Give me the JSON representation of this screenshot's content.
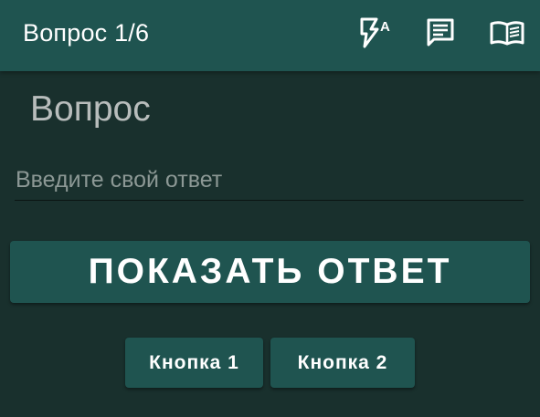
{
  "app_bar": {
    "title": "Вопрос 1/6",
    "actions": [
      {
        "icon": "flash-auto-icon",
        "label": "A"
      },
      {
        "icon": "message-icon"
      },
      {
        "icon": "book-icon"
      }
    ]
  },
  "question": {
    "label": "Вопрос"
  },
  "answer": {
    "placeholder": "Введите свой ответ",
    "value": ""
  },
  "show_answer_button": {
    "label": "ПОКАЗАТЬ ОТВЕТ"
  },
  "buttons": [
    {
      "label": "Кнопка 1"
    },
    {
      "label": "Кнопка 2"
    }
  ],
  "colors": {
    "background": "#19302d",
    "primary": "#1f5450",
    "text": "#ffffff"
  }
}
